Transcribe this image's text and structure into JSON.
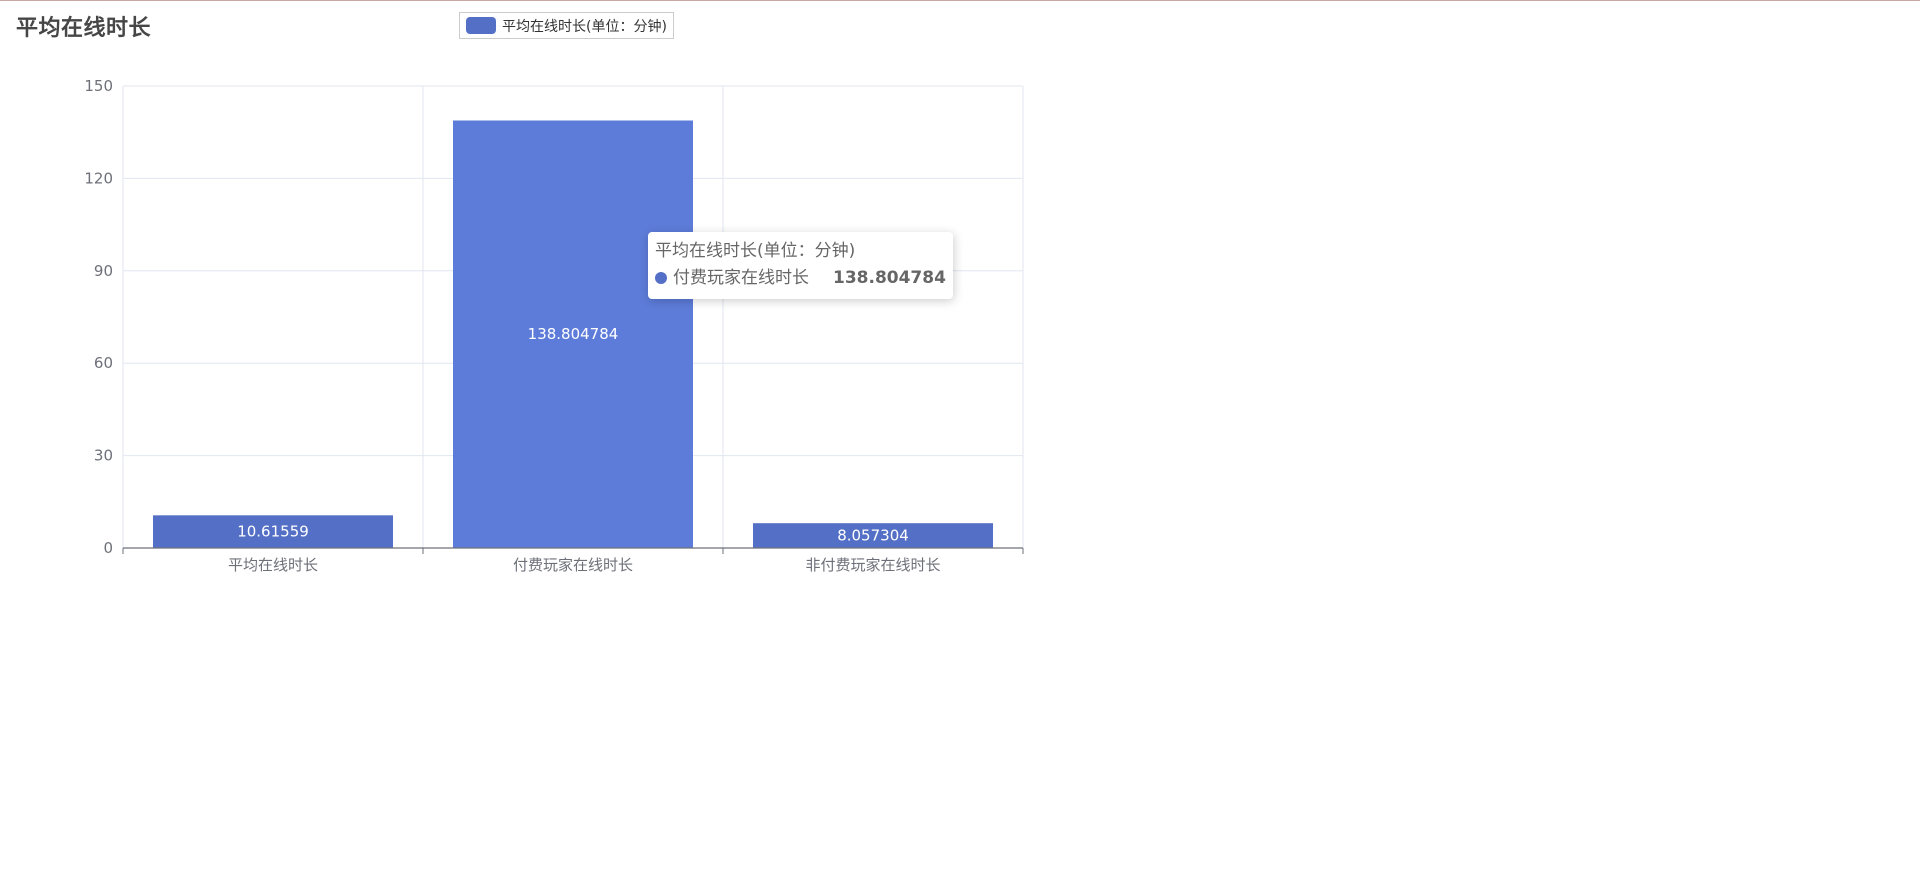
{
  "page": {
    "title": "平均在线时长"
  },
  "legend": {
    "label": "平均在线时长(单位：分钟)"
  },
  "colors": {
    "bar": "#5470c6",
    "bar_highlight": "#5d7cd9",
    "grid": "#e0e6f1",
    "axis": "#6e7079",
    "label": "#6e7079"
  },
  "tooltip": {
    "title": "平均在线时长(单位：分钟)",
    "name": "付费玩家在线时长",
    "value": "138.804784"
  },
  "chart_data": {
    "type": "bar",
    "title": "平均在线时长",
    "categories": [
      "平均在线时长",
      "付费玩家在线时长",
      "非付费玩家在线时长"
    ],
    "series": [
      {
        "name": "平均在线时长(单位：分钟)",
        "values": [
          10.61559,
          138.804784,
          8.057304
        ],
        "labels": [
          "10.61559",
          "138.804784",
          "8.057304"
        ]
      }
    ],
    "ylim": [
      0,
      150
    ],
    "yticks": [
      0,
      30,
      60,
      90,
      120,
      150
    ],
    "xlabel": "",
    "ylabel": "",
    "grid": true,
    "legend_position": "top",
    "highlighted_index": 1
  }
}
